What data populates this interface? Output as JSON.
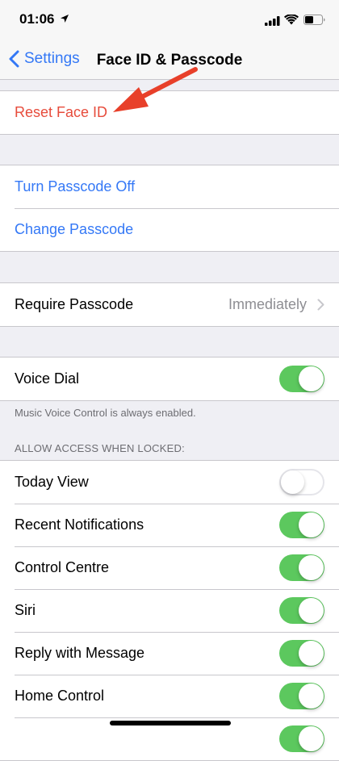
{
  "status": {
    "time": "01:06"
  },
  "nav": {
    "back_label": "Settings",
    "title": "Face ID & Passcode"
  },
  "groups": {
    "reset": {
      "label": "Reset Face ID"
    },
    "passcode": {
      "turn_off": "Turn Passcode Off",
      "change": "Change Passcode"
    },
    "require": {
      "label": "Require Passcode",
      "value": "Immediately"
    },
    "voice": {
      "label": "Voice Dial",
      "on": true,
      "footnote": "Music Voice Control is always enabled."
    }
  },
  "allow_access": {
    "header": "ALLOW ACCESS WHEN LOCKED:",
    "items": [
      {
        "label": "Today View",
        "on": false
      },
      {
        "label": "Recent Notifications",
        "on": true
      },
      {
        "label": "Control Centre",
        "on": true
      },
      {
        "label": "Siri",
        "on": true
      },
      {
        "label": "Reply with Message",
        "on": true
      },
      {
        "label": "Home Control",
        "on": true
      },
      {
        "label": "",
        "on": true
      }
    ]
  },
  "colors": {
    "accent": "#3478f6",
    "destructive": "#e74c3c",
    "toggle_on": "#5cc85e",
    "arrow": "#e8402a"
  }
}
